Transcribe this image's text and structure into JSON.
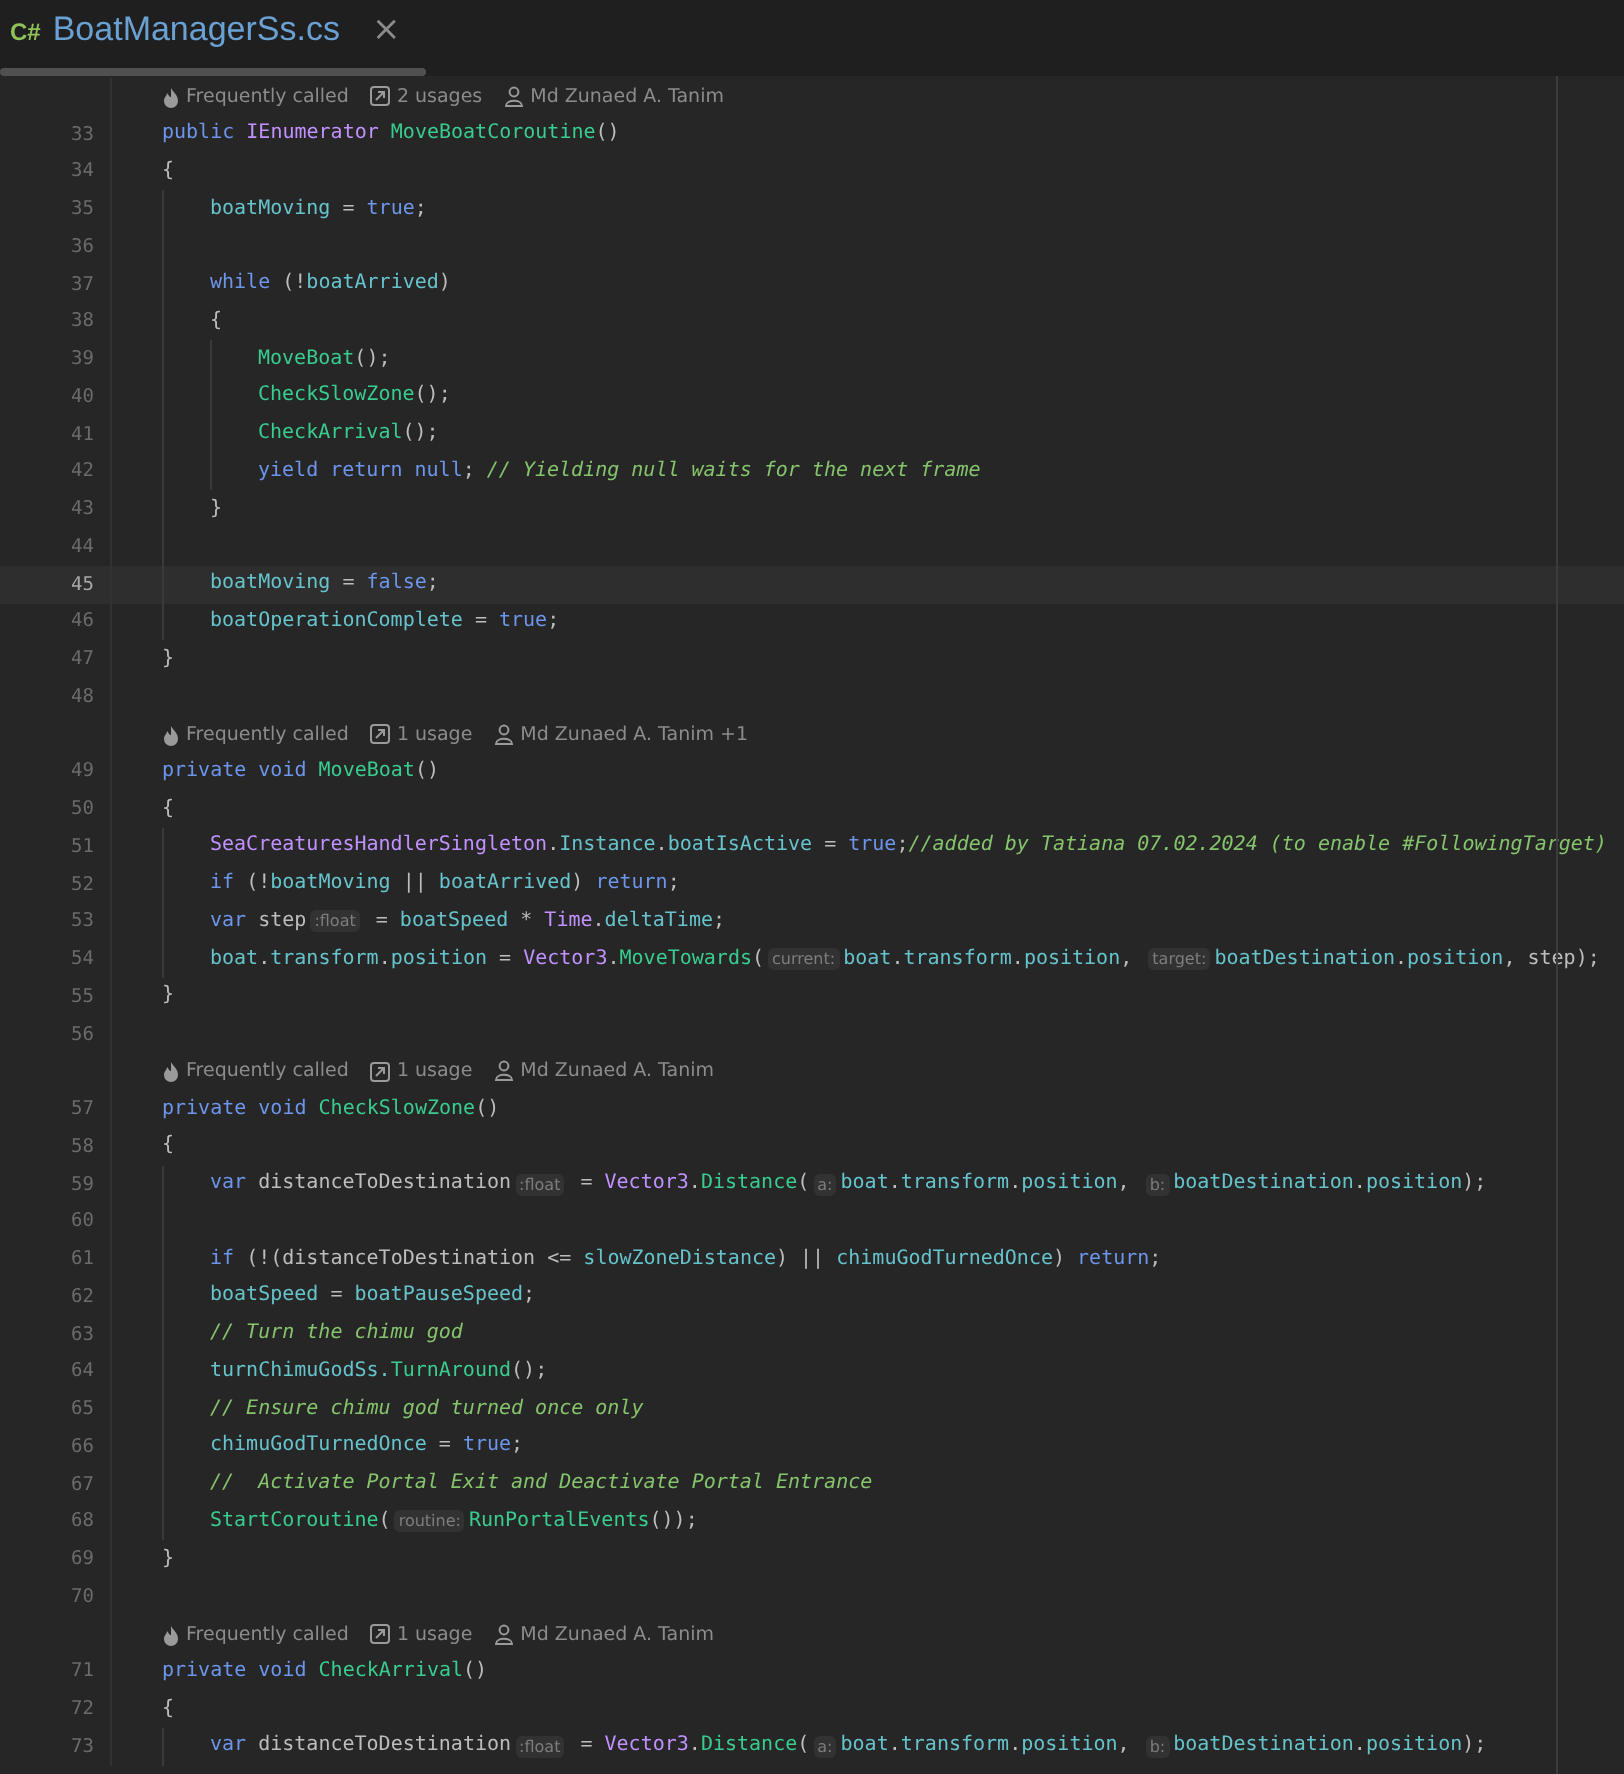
{
  "tab": {
    "language": "C#",
    "title": "BoatManagerSs.cs",
    "close": "×",
    "selected": true
  },
  "editor": {
    "lines": [
      {
        "kind": "lens",
        "called": "Frequently called",
        "usages": "2 usages",
        "author": "Md Zunaed A. Tanim"
      },
      {
        "kind": "code",
        "number": "33",
        "current": false,
        "tokens": [
          {
            "kind": "keyword",
            "text": "public "
          },
          {
            "kind": "type",
            "text": "IEnumerator "
          },
          {
            "kind": "method",
            "text": "MoveBoatCoroutine"
          },
          {
            "kind": "plain",
            "text": "()"
          }
        ]
      },
      {
        "kind": "code",
        "number": "34",
        "current": false,
        "tokens": [
          {
            "kind": "plain",
            "text": "{"
          }
        ],
        "children": [
          {
            "kind": "code",
            "number": "35",
            "current": false,
            "tokens": [
              {
                "kind": "field",
                "text": "boatMoving"
              },
              {
                "kind": "plain",
                "text": " = "
              },
              {
                "kind": "keyword",
                "text": "true"
              },
              {
                "kind": "plain",
                "text": ";"
              }
            ]
          },
          {
            "kind": "code",
            "number": "36",
            "current": false
          },
          {
            "kind": "code",
            "number": "37",
            "current": false,
            "tokens": [
              {
                "kind": "keyword",
                "text": "while"
              },
              {
                "kind": "plain",
                "text": " (!"
              },
              {
                "kind": "field",
                "text": "boatArrived"
              },
              {
                "kind": "plain",
                "text": ")"
              }
            ]
          },
          {
            "kind": "code",
            "number": "38",
            "current": false,
            "tokens": [
              {
                "kind": "plain",
                "text": "{"
              }
            ],
            "children": [
              {
                "kind": "code",
                "number": "39",
                "current": false,
                "tokens": [
                  {
                    "kind": "method",
                    "text": "MoveBoat"
                  },
                  {
                    "kind": "plain",
                    "text": "();"
                  }
                ]
              },
              {
                "kind": "code",
                "number": "40",
                "current": false,
                "tokens": [
                  {
                    "kind": "method",
                    "text": "CheckSlowZone"
                  },
                  {
                    "kind": "plain",
                    "text": "();"
                  }
                ]
              },
              {
                "kind": "code",
                "number": "41",
                "current": false,
                "tokens": [
                  {
                    "kind": "method",
                    "text": "CheckArrival"
                  },
                  {
                    "kind": "plain",
                    "text": "();"
                  }
                ]
              },
              {
                "kind": "code",
                "number": "42",
                "current": false,
                "tokens": [
                  {
                    "kind": "keyword",
                    "text": "yield return null"
                  },
                  {
                    "kind": "plain",
                    "text": "; "
                  },
                  {
                    "kind": "comment",
                    "text": "// Yielding null waits for the next frame"
                  }
                ]
              }
            ]
          },
          {
            "kind": "code",
            "number": "43",
            "current": false,
            "tokens": [
              {
                "kind": "plain",
                "text": "}"
              }
            ]
          },
          {
            "kind": "code",
            "number": "44",
            "current": false
          },
          {
            "kind": "code",
            "number": "45",
            "current": true,
            "tokens": [
              {
                "kind": "field",
                "text": "boatMoving"
              },
              {
                "kind": "plain",
                "text": " = "
              },
              {
                "kind": "keyword",
                "text": "false"
              },
              {
                "kind": "plain",
                "text": ";"
              }
            ]
          },
          {
            "kind": "code",
            "number": "46",
            "current": false,
            "tokens": [
              {
                "kind": "field",
                "text": "boatOperationComplete"
              },
              {
                "kind": "plain",
                "text": " = "
              },
              {
                "kind": "keyword",
                "text": "true"
              },
              {
                "kind": "plain",
                "text": ";"
              }
            ]
          }
        ]
      },
      {
        "kind": "code",
        "number": "47",
        "current": false,
        "tokens": [
          {
            "kind": "plain",
            "text": "}"
          }
        ]
      },
      {
        "kind": "code",
        "number": "48",
        "current": false
      },
      {
        "kind": "lens",
        "called": "Frequently called",
        "usages": "1 usage",
        "author": "Md Zunaed A. Tanim +1"
      },
      {
        "kind": "code",
        "number": "49",
        "current": false,
        "tokens": [
          {
            "kind": "keyword",
            "text": "private void "
          },
          {
            "kind": "method",
            "text": "MoveBoat"
          },
          {
            "kind": "plain",
            "text": "()"
          }
        ]
      },
      {
        "kind": "code",
        "number": "50",
        "current": false,
        "tokens": [
          {
            "kind": "plain",
            "text": "{"
          }
        ],
        "children": [
          {
            "kind": "code",
            "number": "51",
            "current": false,
            "tokens": [
              {
                "kind": "type",
                "text": "SeaCreaturesHandlerSingleton"
              },
              {
                "kind": "plain",
                "text": "."
              },
              {
                "kind": "field",
                "text": "Instance"
              },
              {
                "kind": "plain",
                "text": "."
              },
              {
                "kind": "field",
                "text": "boatIsActive"
              },
              {
                "kind": "plain",
                "text": " = "
              },
              {
                "kind": "keyword",
                "text": "true"
              },
              {
                "kind": "plain",
                "text": ";"
              },
              {
                "kind": "comment",
                "text": "//added by Tatiana 07.02.2024 (to enable #FollowingTarget)"
              }
            ]
          },
          {
            "kind": "code",
            "number": "52",
            "current": false,
            "tokens": [
              {
                "kind": "keyword",
                "text": "if"
              },
              {
                "kind": "plain",
                "text": " (!"
              },
              {
                "kind": "field",
                "text": "boatMoving"
              },
              {
                "kind": "plain",
                "text": " || "
              },
              {
                "kind": "field",
                "text": "boatArrived"
              },
              {
                "kind": "plain",
                "text": ") "
              },
              {
                "kind": "keyword",
                "text": "return"
              },
              {
                "kind": "plain",
                "text": ";"
              }
            ]
          },
          {
            "kind": "code",
            "number": "53",
            "current": false,
            "tokens": [
              {
                "kind": "keyword",
                "text": "var "
              },
              {
                "kind": "local",
                "text": "step"
              },
              {
                "kind": "hint",
                "text": ":float"
              },
              {
                "kind": "plain",
                "text": " = "
              },
              {
                "kind": "field",
                "text": "boatSpeed"
              },
              {
                "kind": "plain",
                "text": " * "
              },
              {
                "kind": "type",
                "text": "Time"
              },
              {
                "kind": "plain",
                "text": "."
              },
              {
                "kind": "field",
                "text": "deltaTime"
              },
              {
                "kind": "plain",
                "text": ";"
              }
            ]
          },
          {
            "kind": "code",
            "number": "54",
            "current": false,
            "tokens": [
              {
                "kind": "field",
                "text": "boat"
              },
              {
                "kind": "plain",
                "text": "."
              },
              {
                "kind": "field",
                "text": "transform"
              },
              {
                "kind": "plain",
                "text": "."
              },
              {
                "kind": "field",
                "text": "position"
              },
              {
                "kind": "plain",
                "text": " = "
              },
              {
                "kind": "type",
                "text": "Vector3"
              },
              {
                "kind": "plain",
                "text": "."
              },
              {
                "kind": "method",
                "text": "MoveTowards"
              },
              {
                "kind": "plain",
                "text": "("
              },
              {
                "kind": "hint",
                "text": "current:"
              },
              {
                "kind": "field",
                "text": "boat"
              },
              {
                "kind": "plain",
                "text": "."
              },
              {
                "kind": "field",
                "text": "transform"
              },
              {
                "kind": "plain",
                "text": "."
              },
              {
                "kind": "field",
                "text": "position"
              },
              {
                "kind": "plain",
                "text": ", "
              },
              {
                "kind": "hint",
                "text": "target:"
              },
              {
                "kind": "field",
                "text": "boatDestination"
              },
              {
                "kind": "plain",
                "text": "."
              },
              {
                "kind": "field",
                "text": "position"
              },
              {
                "kind": "plain",
                "text": ", "
              },
              {
                "kind": "local",
                "text": "step"
              },
              {
                "kind": "plain",
                "text": ");"
              }
            ]
          }
        ]
      },
      {
        "kind": "code",
        "number": "55",
        "current": false,
        "tokens": [
          {
            "kind": "plain",
            "text": "}"
          }
        ]
      },
      {
        "kind": "code",
        "number": "56",
        "current": false
      },
      {
        "kind": "lens",
        "called": "Frequently called",
        "usages": "1 usage",
        "author": "Md Zunaed A. Tanim"
      },
      {
        "kind": "code",
        "number": "57",
        "current": false,
        "tokens": [
          {
            "kind": "keyword",
            "text": "private void "
          },
          {
            "kind": "method",
            "text": "CheckSlowZone"
          },
          {
            "kind": "plain",
            "text": "()"
          }
        ]
      },
      {
        "kind": "code",
        "number": "58",
        "current": false,
        "tokens": [
          {
            "kind": "plain",
            "text": "{"
          }
        ],
        "children": [
          {
            "kind": "code",
            "number": "59",
            "current": false,
            "tokens": [
              {
                "kind": "keyword",
                "text": "var "
              },
              {
                "kind": "local",
                "text": "distanceToDestination"
              },
              {
                "kind": "hint",
                "text": ":float"
              },
              {
                "kind": "plain",
                "text": " = "
              },
              {
                "kind": "type",
                "text": "Vector3"
              },
              {
                "kind": "plain",
                "text": "."
              },
              {
                "kind": "method",
                "text": "Distance"
              },
              {
                "kind": "plain",
                "text": "("
              },
              {
                "kind": "hint",
                "text": "a:"
              },
              {
                "kind": "field",
                "text": "boat"
              },
              {
                "kind": "plain",
                "text": "."
              },
              {
                "kind": "field",
                "text": "transform"
              },
              {
                "kind": "plain",
                "text": "."
              },
              {
                "kind": "field",
                "text": "position"
              },
              {
                "kind": "plain",
                "text": ", "
              },
              {
                "kind": "hint",
                "text": "b:"
              },
              {
                "kind": "field",
                "text": "boatDestination"
              },
              {
                "kind": "plain",
                "text": "."
              },
              {
                "kind": "field",
                "text": "position"
              },
              {
                "kind": "plain",
                "text": ");"
              }
            ]
          },
          {
            "kind": "code",
            "number": "60",
            "current": false
          },
          {
            "kind": "code",
            "number": "61",
            "current": false,
            "tokens": [
              {
                "kind": "keyword",
                "text": "if"
              },
              {
                "kind": "plain",
                "text": " (!("
              },
              {
                "kind": "local",
                "text": "distanceToDestination"
              },
              {
                "kind": "plain",
                "text": " <= "
              },
              {
                "kind": "field",
                "text": "slowZoneDistance"
              },
              {
                "kind": "plain",
                "text": ") || "
              },
              {
                "kind": "field",
                "text": "chimuGodTurnedOnce"
              },
              {
                "kind": "plain",
                "text": ") "
              },
              {
                "kind": "keyword",
                "text": "return"
              },
              {
                "kind": "plain",
                "text": ";"
              }
            ]
          },
          {
            "kind": "code",
            "number": "62",
            "current": false,
            "tokens": [
              {
                "kind": "field",
                "text": "boatSpeed"
              },
              {
                "kind": "plain",
                "text": " = "
              },
              {
                "kind": "field",
                "text": "boatPauseSpeed"
              },
              {
                "kind": "plain",
                "text": ";"
              }
            ]
          },
          {
            "kind": "code",
            "number": "63",
            "current": false,
            "tokens": [
              {
                "kind": "comment",
                "text": "// Turn the chimu god"
              }
            ]
          },
          {
            "kind": "code",
            "number": "64",
            "current": false,
            "tokens": [
              {
                "kind": "field",
                "text": "turnChimuGodSs."
              },
              {
                "kind": "method",
                "text": "TurnAround"
              },
              {
                "kind": "plain",
                "text": "();"
              }
            ]
          },
          {
            "kind": "code",
            "number": "65",
            "current": false,
            "tokens": [
              {
                "kind": "comment",
                "text": "// Ensure chimu god turned once only"
              }
            ]
          },
          {
            "kind": "code",
            "number": "66",
            "current": false,
            "tokens": [
              {
                "kind": "field",
                "text": "chimuGodTurnedOnce"
              },
              {
                "kind": "plain",
                "text": " = "
              },
              {
                "kind": "keyword",
                "text": "true"
              },
              {
                "kind": "plain",
                "text": ";"
              }
            ]
          },
          {
            "kind": "code",
            "number": "67",
            "current": false,
            "tokens": [
              {
                "kind": "comment",
                "text": "//  Activate Portal Exit and Deactivate Portal Entrance"
              }
            ]
          },
          {
            "kind": "code",
            "number": "68",
            "current": false,
            "tokens": [
              {
                "kind": "method",
                "text": "StartCoroutine"
              },
              {
                "kind": "plain",
                "text": "("
              },
              {
                "kind": "hint",
                "text": "routine:"
              },
              {
                "kind": "method",
                "text": "RunPortalEvents"
              },
              {
                "kind": "plain",
                "text": "());"
              }
            ]
          }
        ]
      },
      {
        "kind": "code",
        "number": "69",
        "current": false,
        "tokens": [
          {
            "kind": "plain",
            "text": "}"
          }
        ]
      },
      {
        "kind": "code",
        "number": "70",
        "current": false
      },
      {
        "kind": "lens",
        "called": "Frequently called",
        "usages": "1 usage",
        "author": "Md Zunaed A. Tanim"
      },
      {
        "kind": "code",
        "number": "71",
        "current": false,
        "tokens": [
          {
            "kind": "keyword",
            "text": "private void "
          },
          {
            "kind": "method",
            "text": "CheckArrival"
          },
          {
            "kind": "plain",
            "text": "()"
          }
        ]
      },
      {
        "kind": "code",
        "number": "72",
        "current": false,
        "tokens": [
          {
            "kind": "plain",
            "text": "{"
          }
        ],
        "children": [
          {
            "kind": "code",
            "number": "73",
            "current": false,
            "tokens": [
              {
                "kind": "keyword",
                "text": "var "
              },
              {
                "kind": "local",
                "text": "distanceToDestination"
              },
              {
                "kind": "hint",
                "text": ":float"
              },
              {
                "kind": "plain",
                "text": " = "
              },
              {
                "kind": "type",
                "text": "Vector3"
              },
              {
                "kind": "plain",
                "text": "."
              },
              {
                "kind": "method",
                "text": "Distance"
              },
              {
                "kind": "plain",
                "text": "("
              },
              {
                "kind": "hint",
                "text": "a:"
              },
              {
                "kind": "field",
                "text": "boat"
              },
              {
                "kind": "plain",
                "text": "."
              },
              {
                "kind": "field",
                "text": "transform"
              },
              {
                "kind": "plain",
                "text": "."
              },
              {
                "kind": "field",
                "text": "position"
              },
              {
                "kind": "plain",
                "text": ", "
              },
              {
                "kind": "hint",
                "text": "b:"
              },
              {
                "kind": "field",
                "text": "boatDestination"
              },
              {
                "kind": "plain",
                "text": "."
              },
              {
                "kind": "field",
                "text": "position"
              },
              {
                "kind": "plain",
                "text": ");"
              }
            ]
          }
        ]
      }
    ]
  }
}
